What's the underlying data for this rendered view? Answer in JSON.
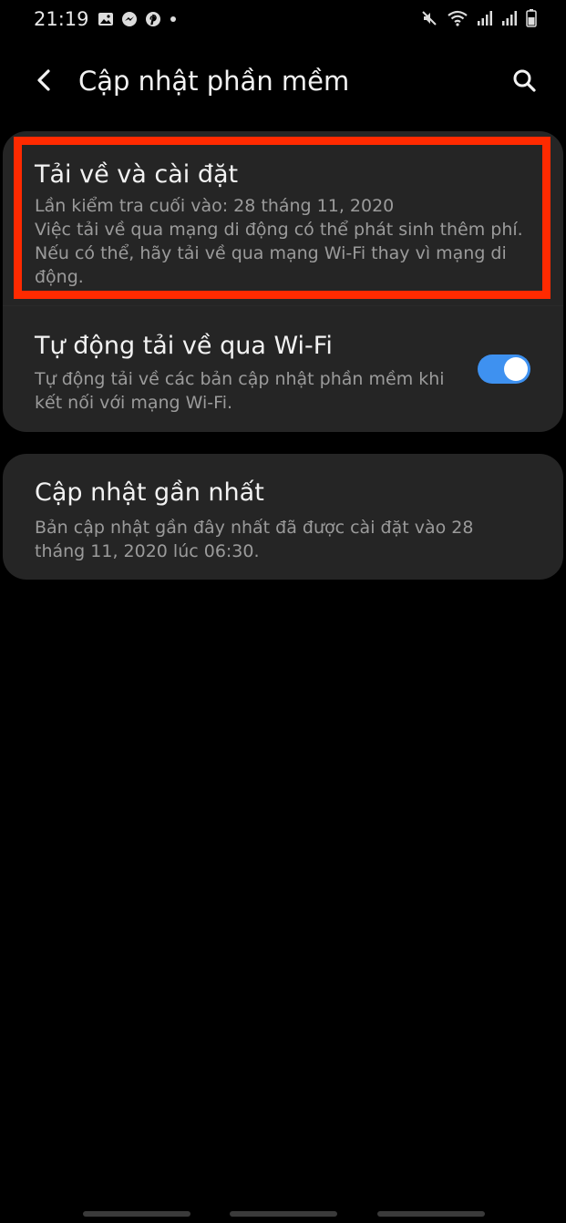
{
  "status_bar": {
    "time": "21:19",
    "left_icons": [
      "gallery-icon",
      "messenger-icon",
      "pinterest-icon",
      "dot-icon"
    ],
    "right_icons": [
      "mute-icon",
      "wifi-icon",
      "signal-icon",
      "signal-icon-2",
      "battery-icon"
    ]
  },
  "header": {
    "title": "Cập nhật phần mềm",
    "back_icon": "chevron-left-icon",
    "search_icon": "search-icon"
  },
  "items": {
    "download": {
      "title": "Tải về và cài đặt",
      "last_check": "Lần kiểm tra cuối vào: 28 tháng 11, 2020",
      "note": "Việc tải về qua mạng di động có thể phát sinh thêm phí. Nếu có thể, hãy tải về qua mạng Wi-Fi thay vì mạng di động."
    },
    "auto_wifi": {
      "title": "Tự động tải về qua Wi-Fi",
      "description": "Tự động tải về các bản cập nhật phần mềm khi kết nối với mạng Wi-Fi.",
      "enabled": true
    },
    "last_update": {
      "title": "Cập nhật gần nhất",
      "description": "Bản cập nhật gần đây nhất đã được cài đặt vào 28 tháng 11, 2020 lúc 06:30."
    }
  },
  "colors": {
    "background": "#000000",
    "card": "#252525",
    "highlight": "#ff2a00",
    "toggle_on": "#3e91f0",
    "secondary_text": "#9b9b9b"
  }
}
